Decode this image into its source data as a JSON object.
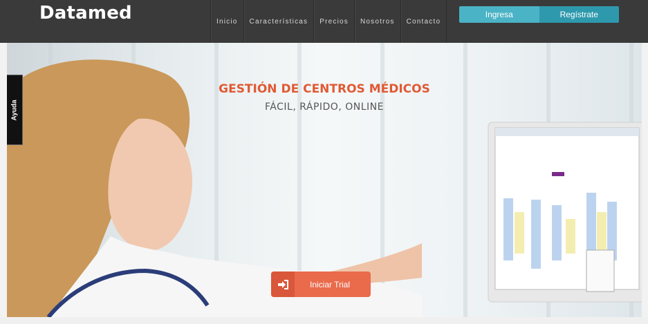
{
  "header": {
    "brand": "Datamed",
    "nav": [
      "Inicio",
      "Características",
      "Precios",
      "Nosotros",
      "Contacto"
    ],
    "login_label": "Ingresa",
    "register_label": "Regístrate"
  },
  "hero": {
    "title": "GESTIÓN DE CENTROS MÉDICOS",
    "subtitle": "FÁCIL, RÁPIDO, ONLINE",
    "cta_label": "Iniciar Trial",
    "cta_icon": "sign-in-icon"
  },
  "side_tab": {
    "label": "Ayuda"
  },
  "colors": {
    "accent": "#e05a34",
    "cta": "#ea6a4c",
    "teal": "#4bb3c6",
    "teal_dark": "#2e99ad",
    "header_bg": "#3a3a3a"
  }
}
